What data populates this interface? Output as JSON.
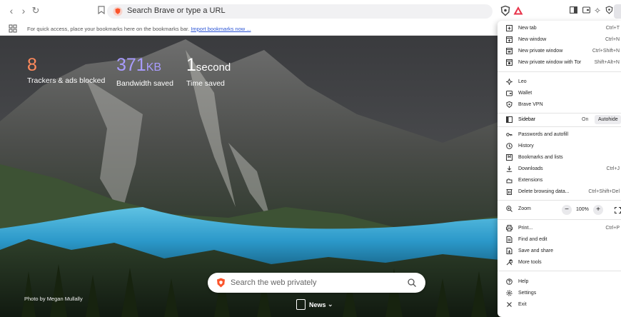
{
  "toolbar": {
    "url_placeholder": "Search Brave or type a URL",
    "back_icon": "chevron-left-icon",
    "forward_icon": "chevron-right-icon",
    "reload_icon": "reload-icon",
    "bookmark_icon": "bookmark-icon"
  },
  "bookmarks_bar": {
    "message": "For quick access, place your bookmarks here on the bookmarks bar.",
    "import_link": "Import bookmarks now ..."
  },
  "stats": [
    {
      "value": "8",
      "unit": "",
      "label": "Trackers & ads blocked",
      "color": "#ff8a5c"
    },
    {
      "value": "371",
      "unit": "KB",
      "label": "Bandwidth saved",
      "color": "#a99cff"
    },
    {
      "value": "1",
      "unit": "second",
      "label": "Time saved",
      "color": "#ffffff"
    }
  ],
  "search": {
    "placeholder": "Search the web privately"
  },
  "photo_credit": "Photo by Megan Mullally",
  "news": {
    "label": "News"
  },
  "menu": {
    "items": [
      {
        "label": "New tab",
        "shortcut": "Ctrl+T",
        "icon": "new-tab-icon"
      },
      {
        "label": "New window",
        "shortcut": "Ctrl+N",
        "icon": "new-window-icon"
      },
      {
        "label": "New private window",
        "shortcut": "Ctrl+Shift+N",
        "icon": "private-window-icon"
      },
      {
        "label": "New private window with Tor",
        "shortcut": "Shift+Alt+N",
        "icon": "tor-window-icon"
      },
      {
        "label": "Leo",
        "shortcut": "",
        "icon": "leo-icon"
      },
      {
        "label": "Wallet",
        "shortcut": "",
        "icon": "wallet-icon"
      },
      {
        "label": "Brave VPN",
        "shortcut": "",
        "icon": "vpn-icon"
      },
      {
        "label": "Passwords and autofill",
        "shortcut": "",
        "icon": "key-icon"
      },
      {
        "label": "History",
        "shortcut": "",
        "icon": "history-icon"
      },
      {
        "label": "Bookmarks and lists",
        "shortcut": "",
        "icon": "bookmarks-icon"
      },
      {
        "label": "Downloads",
        "shortcut": "Ctrl+J",
        "icon": "download-icon"
      },
      {
        "label": "Extensions",
        "shortcut": "",
        "icon": "extensions-icon"
      },
      {
        "label": "Delete browsing data...",
        "shortcut": "Ctrl+Shift+Del",
        "icon": "trash-icon"
      },
      {
        "label": "Print...",
        "shortcut": "Ctrl+P",
        "icon": "print-icon"
      },
      {
        "label": "Find and edit",
        "shortcut": "",
        "icon": "find-icon"
      },
      {
        "label": "Save and share",
        "shortcut": "",
        "icon": "save-icon"
      },
      {
        "label": "More tools",
        "shortcut": "",
        "icon": "tools-icon"
      },
      {
        "label": "Help",
        "shortcut": "",
        "icon": "help-icon"
      },
      {
        "label": "Settings",
        "shortcut": "",
        "icon": "gear-icon"
      },
      {
        "label": "Exit",
        "shortcut": "",
        "icon": "close-icon"
      }
    ],
    "sidebar": {
      "label": "Sidebar",
      "option_on": "On",
      "option_selected": "Autohide"
    },
    "zoom": {
      "label": "Zoom",
      "minus": "−",
      "value": "100%",
      "plus": "+"
    }
  },
  "colors": {
    "brave_orange": "#fb542b",
    "lake": "#2fa8d8"
  }
}
